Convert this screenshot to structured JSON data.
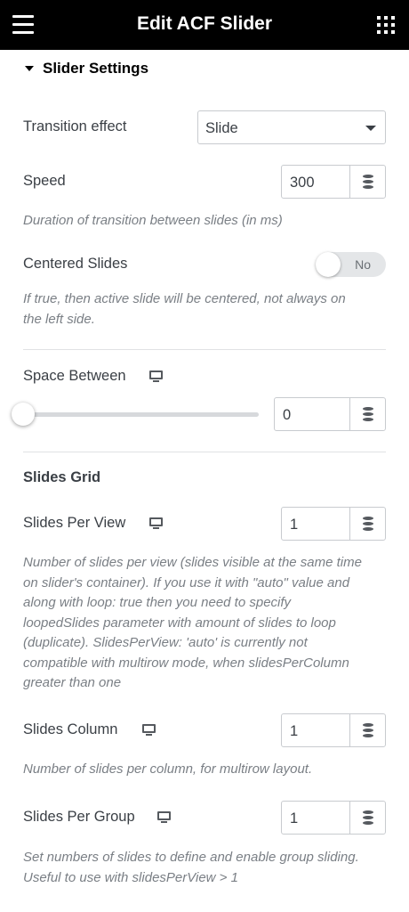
{
  "header": {
    "title": "Edit ACF Slider",
    "menu_icon": "hamburger-menu-icon",
    "apps_icon": "grid-apps-icon"
  },
  "section": {
    "label": "Slider Settings"
  },
  "transition_effect": {
    "label": "Transition effect",
    "value": "Slide"
  },
  "speed": {
    "label": "Speed",
    "value": "300",
    "description": "Duration of transition between slides (in ms)"
  },
  "centered_slides": {
    "label": "Centered Slides",
    "toggle_text": "No",
    "description_lines": [
      "If true, then active slide will be centered, not always on",
      "the left side."
    ]
  },
  "space_between": {
    "label": "Space Between",
    "value": "0",
    "slider_level": 0
  },
  "slides_grid": {
    "title": "Slides Grid"
  },
  "slides_per_view": {
    "label": "Slides Per View",
    "value": "1",
    "description_lines": [
      "Number of slides per view (slides visible at the same time",
      "on slider's container). If you use it with \"auto\" value and",
      "along with loop: true then you need to specify",
      "loopedSlides parameter with amount of slides to loop",
      "(duplicate). SlidesPerView: 'auto' is currently not",
      "compatible with multirow mode, when slidesPerColumn",
      "greater than one"
    ]
  },
  "slides_column": {
    "label": "Slides Column",
    "value": "1",
    "description": "Number of slides per column, for multirow layout."
  },
  "slides_per_group": {
    "label": "Slides Per Group",
    "value": "1",
    "description_lines": [
      "Set numbers of slides to define and enable group sliding.",
      "Useful to use with slidesPerView > 1"
    ]
  },
  "colors": {
    "topbar": "#000000",
    "text": "#3a3f45",
    "muted": "#7a7f85",
    "border": "#c8cbcf"
  }
}
